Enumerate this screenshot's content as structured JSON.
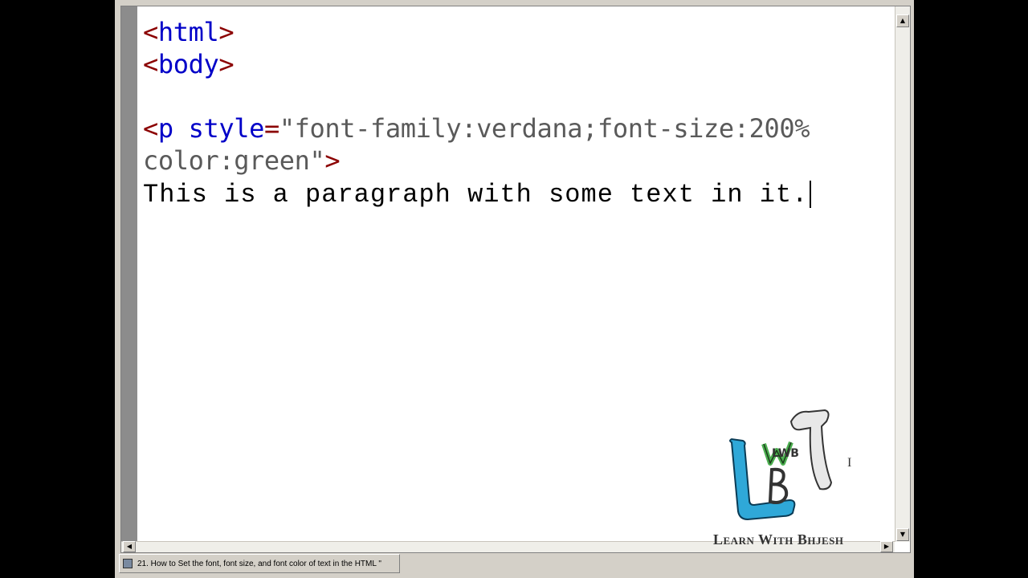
{
  "editor": {
    "lines": [
      {
        "parts": [
          {
            "cls": "tag",
            "text": "<"
          },
          {
            "cls": "name",
            "text": "html"
          },
          {
            "cls": "tag",
            "text": ">"
          }
        ]
      },
      {
        "parts": [
          {
            "cls": "tag",
            "text": "<"
          },
          {
            "cls": "name",
            "text": "body"
          },
          {
            "cls": "tag",
            "text": ">"
          }
        ]
      },
      {
        "parts": []
      },
      {
        "parts": [
          {
            "cls": "tag",
            "text": "<"
          },
          {
            "cls": "name",
            "text": "p style"
          },
          {
            "cls": "tag",
            "text": "="
          },
          {
            "cls": "str",
            "text": "\"font-family:verdana;font-size:200%"
          }
        ]
      },
      {
        "parts": [
          {
            "cls": "str",
            "text": "color:green\""
          },
          {
            "cls": "tag",
            "text": ">"
          }
        ]
      },
      {
        "parts": [
          {
            "cls": "plain",
            "text": "This is a paragraph with some text in it."
          }
        ],
        "caret": true
      }
    ]
  },
  "scrollbar": {
    "up_arrow": "▲",
    "down_arrow": "▼",
    "left_arrow": "◀",
    "right_arrow": "▶"
  },
  "taskbar": {
    "task_label": "21. How to Set the font, font size, and font color of text in the HTML \""
  },
  "watermark": {
    "brand": "Learn With Bhjesh",
    "logo_letters": "LWB",
    "cursor_glyph": "I"
  },
  "colors": {
    "tag": "#8b0000",
    "name": "#0000c8",
    "string": "#5a5a5a",
    "logo_blue": "#2fa8d8",
    "logo_green": "#4caf50"
  }
}
